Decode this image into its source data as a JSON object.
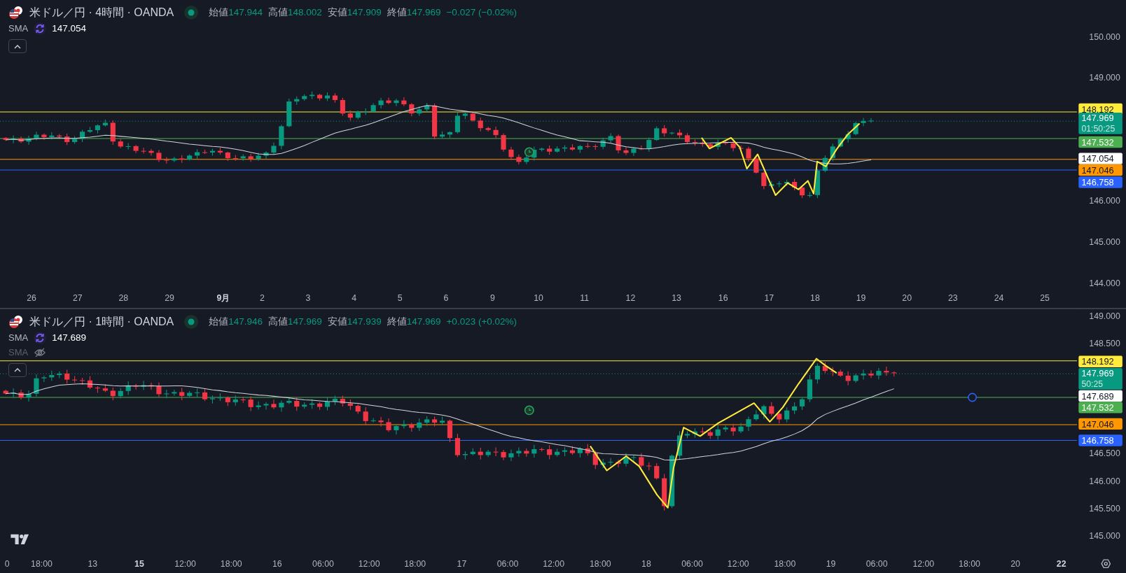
{
  "panes": [
    {
      "title": "米ドル／円 · 4時間 · OANDA",
      "market_open": true,
      "ohlc": [
        {
          "label": "始値",
          "value": "147.944"
        },
        {
          "label": "高値",
          "value": "148.002"
        },
        {
          "label": "安値",
          "value": "147.909"
        },
        {
          "label": "終値",
          "value": "147.969"
        }
      ],
      "change": "−0.027 (−0.02%)",
      "indicators": [
        {
          "name": "SMA",
          "value": "147.054",
          "visible": true
        }
      ],
      "price_ticks": [
        "150.000",
        "149.000",
        "146.000",
        "145.000",
        "144.000"
      ],
      "price_labels": [
        {
          "text": "148.192",
          "color": "#ffeb3b"
        },
        {
          "text": "147.969",
          "countdown": "01:50:25",
          "color": "#089981"
        },
        {
          "text": "147.532",
          "color": "#4caf50"
        },
        {
          "text": "147.054",
          "color": "#ffffff"
        },
        {
          "text": "147.046",
          "color": "#ff9800"
        },
        {
          "text": "146.758",
          "color": "#2962ff"
        }
      ],
      "time_ticks": [
        {
          "label": "26",
          "bold": false
        },
        {
          "label": "27",
          "bold": false
        },
        {
          "label": "28",
          "bold": false
        },
        {
          "label": "29",
          "bold": false
        },
        {
          "label": "9月",
          "bold": true
        },
        {
          "label": "2",
          "bold": false
        },
        {
          "label": "3",
          "bold": false
        },
        {
          "label": "4",
          "bold": false
        },
        {
          "label": "5",
          "bold": false
        },
        {
          "label": "6",
          "bold": false
        },
        {
          "label": "9",
          "bold": false
        },
        {
          "label": "10",
          "bold": false
        },
        {
          "label": "11",
          "bold": false
        },
        {
          "label": "12",
          "bold": false
        },
        {
          "label": "13",
          "bold": false
        },
        {
          "label": "16",
          "bold": false
        },
        {
          "label": "17",
          "bold": false
        },
        {
          "label": "18",
          "bold": false
        },
        {
          "label": "19",
          "bold": false
        },
        {
          "label": "20",
          "bold": false
        },
        {
          "label": "23",
          "bold": false
        },
        {
          "label": "24",
          "bold": false
        },
        {
          "label": "25",
          "bold": false
        }
      ]
    },
    {
      "title": "米ドル／円 · 1時間 · OANDA",
      "market_open": true,
      "ohlc": [
        {
          "label": "始値",
          "value": "147.946"
        },
        {
          "label": "高値",
          "value": "147.969"
        },
        {
          "label": "安値",
          "value": "147.939"
        },
        {
          "label": "終値",
          "value": "147.969"
        }
      ],
      "change": "+0.023 (+0.02%)",
      "indicators": [
        {
          "name": "SMA",
          "value": "147.689",
          "visible": true
        },
        {
          "name": "SMA",
          "visible": false
        }
      ],
      "price_ticks": [
        "149.000",
        "148.500",
        "146.500",
        "146.000",
        "145.500",
        "145.000"
      ],
      "price_labels": [
        {
          "text": "148.192",
          "color": "#ffeb3b"
        },
        {
          "text": "147.969",
          "countdown": "50:25",
          "color": "#089981"
        },
        {
          "text": "147.689",
          "color": "#ffffff"
        },
        {
          "text": "147.532",
          "color": "#4caf50"
        },
        {
          "text": "147.046",
          "color": "#ff9800"
        },
        {
          "text": "146.758",
          "color": "#2962ff"
        }
      ],
      "time_ticks": [
        {
          "label": "0",
          "bold": false
        },
        {
          "label": "18:00",
          "bold": false
        },
        {
          "label": "13",
          "bold": false
        },
        {
          "label": "15",
          "bold": true
        },
        {
          "label": "12:00",
          "bold": false
        },
        {
          "label": "18:00",
          "bold": false
        },
        {
          "label": "16",
          "bold": false
        },
        {
          "label": "06:00",
          "bold": false
        },
        {
          "label": "12:00",
          "bold": false
        },
        {
          "label": "18:00",
          "bold": false
        },
        {
          "label": "17",
          "bold": false
        },
        {
          "label": "06:00",
          "bold": false
        },
        {
          "label": "12:00",
          "bold": false
        },
        {
          "label": "18:00",
          "bold": false
        },
        {
          "label": "18",
          "bold": false
        },
        {
          "label": "06:00",
          "bold": false
        },
        {
          "label": "12:00",
          "bold": false
        },
        {
          "label": "18:00",
          "bold": false
        },
        {
          "label": "19",
          "bold": false
        },
        {
          "label": "06:00",
          "bold": false
        },
        {
          "label": "12:00",
          "bold": false
        },
        {
          "label": "18:00",
          "bold": false
        },
        {
          "label": "20",
          "bold": false
        },
        {
          "label": "22",
          "bold": true
        }
      ]
    }
  ]
}
